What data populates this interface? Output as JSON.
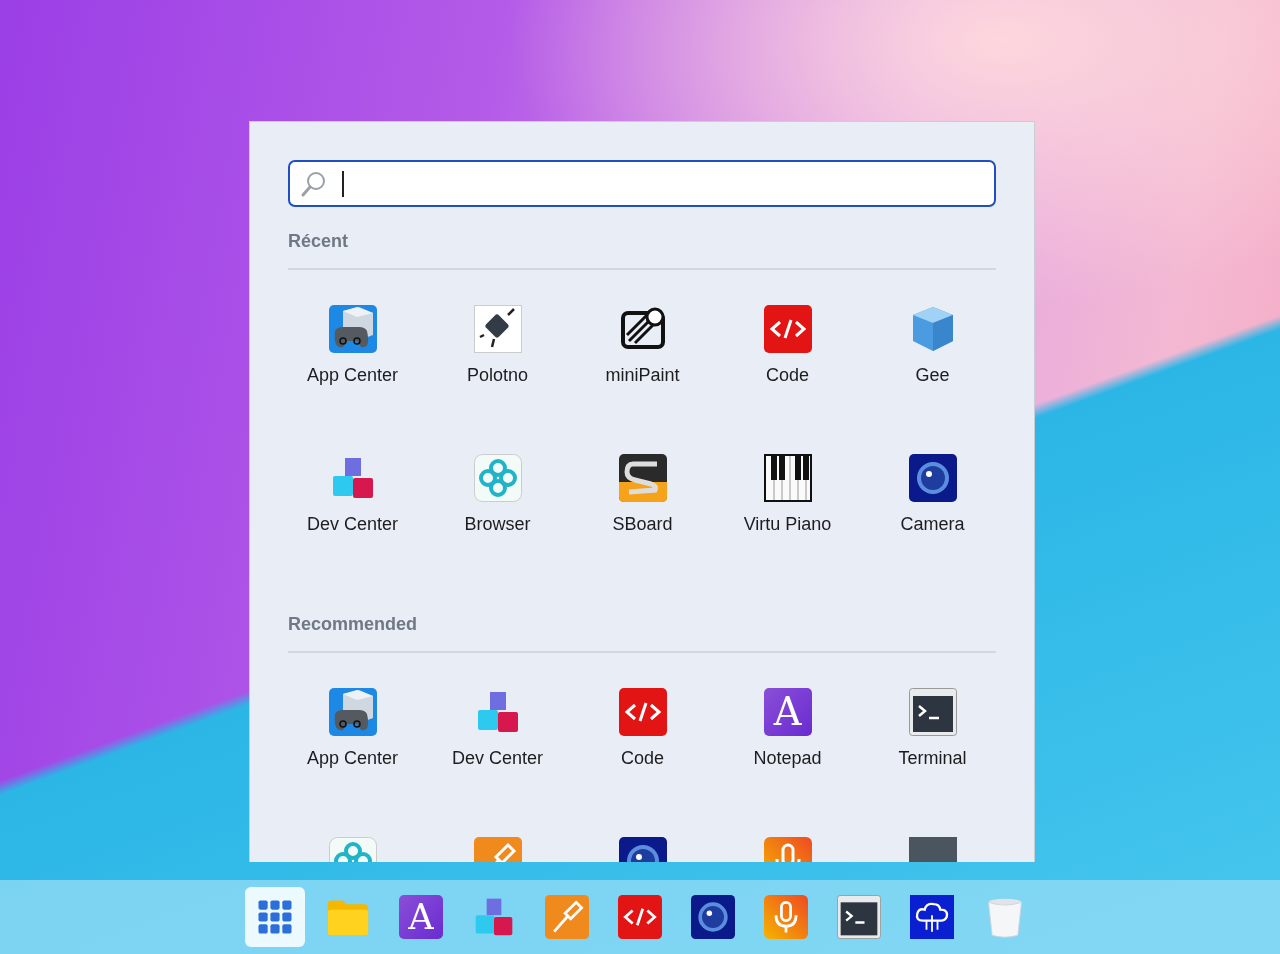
{
  "sections": [
    {
      "title": "Récent",
      "items": [
        {
          "label": "App Center",
          "kind": "gamepad"
        },
        {
          "label": "Polotno",
          "kind": "plug"
        },
        {
          "label": "miniPaint",
          "kind": "paint"
        },
        {
          "label": "Code",
          "kind": "code"
        },
        {
          "label": "Gee",
          "kind": "cube"
        },
        {
          "label": "Dev Center",
          "kind": "cubes"
        },
        {
          "label": "Browser",
          "kind": "knot"
        },
        {
          "label": "SBoard",
          "kind": "sboard"
        },
        {
          "label": "Virtu Piano",
          "kind": "piano"
        },
        {
          "label": "Camera",
          "kind": "camera"
        }
      ]
    },
    {
      "title": "Recommended",
      "items": [
        {
          "label": "App Center",
          "kind": "gamepad"
        },
        {
          "label": "Dev Center",
          "kind": "cubes"
        },
        {
          "label": "Code",
          "kind": "code"
        },
        {
          "label": "Notepad",
          "kind": "notepad",
          "glyph": "A"
        },
        {
          "label": "Terminal",
          "kind": "terminal"
        },
        {
          "kind": "knot"
        },
        {
          "kind": "brush"
        },
        {
          "kind": "camera"
        },
        {
          "kind": "mic"
        },
        {
          "kind": "photo"
        }
      ]
    }
  ],
  "dock": [
    {
      "kind": "grid",
      "selected": true
    },
    {
      "kind": "folder",
      "selected": false
    },
    {
      "kind": "notepad",
      "glyph": "A",
      "selected": false
    },
    {
      "kind": "cubes",
      "selected": false
    },
    {
      "kind": "brush",
      "selected": false
    },
    {
      "kind": "code",
      "selected": false
    },
    {
      "kind": "camera",
      "selected": false
    },
    {
      "kind": "mic",
      "selected": false
    },
    {
      "kind": "terminal",
      "selected": false
    },
    {
      "kind": "cloud",
      "selected": false
    },
    {
      "kind": "trash",
      "selected": false
    }
  ]
}
